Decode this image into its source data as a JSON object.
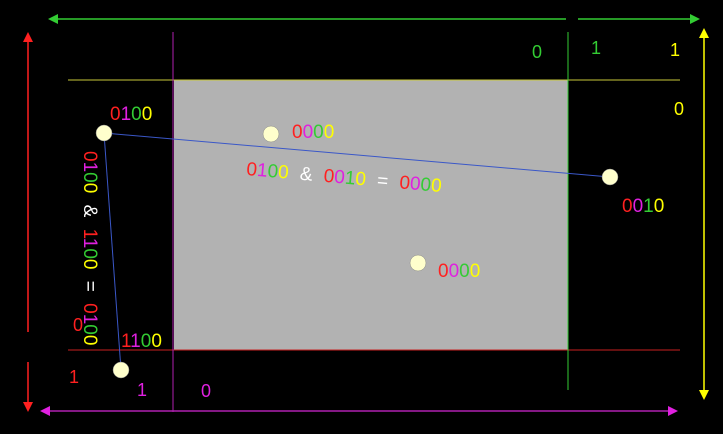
{
  "colors": {
    "background": "#000000",
    "clip_window": "#b2b2b2",
    "bit_red": "#ff2020",
    "bit_magenta": "#e020e0",
    "bit_green": "#33cc33",
    "bit_yellow": "#ffff00",
    "operator_white": "#ffffff",
    "segment_line": "#3a57c8",
    "point_fill": "#ffffcc"
  },
  "region_labels": {
    "top_green_0": "0",
    "top_green_1": "1",
    "top_yellow_1": "1",
    "right_yellow_0": "0",
    "left_red_0": "0",
    "left_red_1": "1",
    "bottom_magenta_1": "1",
    "bottom_magenta_0": "0"
  },
  "point_codes": {
    "p1": "0100",
    "p2": "0000",
    "p3": "0010",
    "p4": "0000",
    "p5": "1100"
  },
  "equations": {
    "horizontal": {
      "a": "0100",
      "op": "&",
      "b": "0010",
      "eq": "=",
      "r": "0000"
    },
    "vertical": {
      "a": "0100",
      "op": "&",
      "b": "1100",
      "eq": "=",
      "r": "0100"
    }
  }
}
